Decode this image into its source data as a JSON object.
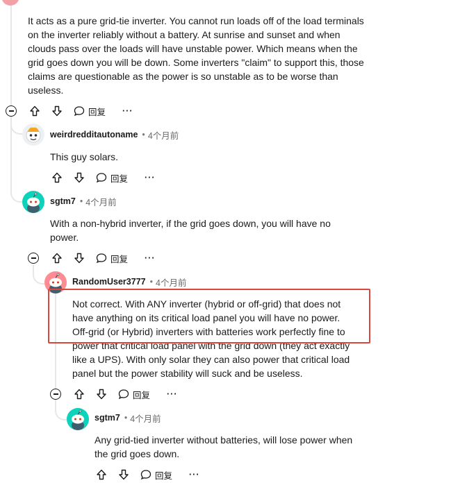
{
  "comments": [
    {
      "body": "It acts as a pure grid-tie inverter. You cannot run loads off of the load terminals on the inverter reliably without a battery. At sunrise and sunset and when clouds pass over the loads will have unstable power. Which means when the grid goes down you will be down. Some inverters \"claim\" to support this, those claims are questionable as the power is so unstable as to be worse than useless.",
      "reply_label": "回复"
    },
    {
      "author": "weirdredditautoname",
      "time": "4个月前",
      "body": "This guy solars.",
      "reply_label": "回复"
    },
    {
      "author": "sgtm7",
      "time": "4个月前",
      "body": "With a non-hybrid inverter, if the grid goes down, you will have no power.",
      "reply_label": "回复"
    },
    {
      "author": "RandomUser3777",
      "time": "4个月前",
      "body": "Not correct. With ANY inverter (hybrid or off-grid) that does not have anything on its critical load panel you will have no power. Off-grid (or Hybrid) inverters with batteries work perfectly fine to power that critical load panel with the grid down (they act exactly like a UPS). With only solar they can also power that critical load panel but the power stability will suck and be useless.",
      "reply_label": "回复"
    },
    {
      "author": "sgtm7",
      "time": "4个月前",
      "body": "Any grid-tied inverter without batteries, will lose power when the grid goes down.",
      "reply_label": "回复"
    }
  ],
  "more_label": "···",
  "colors": {
    "highlight": "#d9463c",
    "thread_line": "#e5e7e9",
    "snoo_blue": "#0dd3bb",
    "snoo_pink": "#ff8b93"
  }
}
